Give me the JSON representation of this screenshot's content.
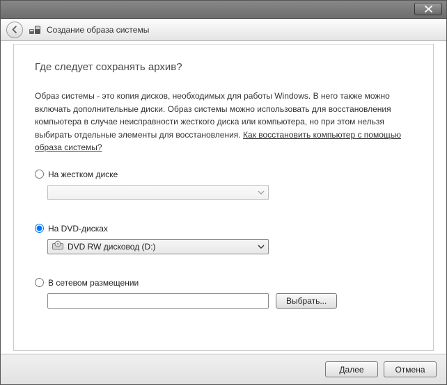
{
  "header": {
    "title": "Создание образа системы"
  },
  "page": {
    "heading": "Где следует сохранять архив?",
    "description_pre": "Образ системы - это копия дисков, необходимых для работы Windows. В него также можно включать дополнительные диски. Образ системы можно использовать для восстановления компьютера в случае неисправности жесткого диска или компьютера, но при этом нельзя выбирать отдельные элементы для восстановления. ",
    "description_link": "Как восстановить компьютер с помощью образа системы?"
  },
  "options": {
    "hdd": {
      "label": "На жестком диске",
      "selected": ""
    },
    "dvd": {
      "label": "На DVD-дисках",
      "selected": "DVD RW дисковод (D:)"
    },
    "network": {
      "label": "В сетевом размещении",
      "value": "",
      "browse": "Выбрать..."
    }
  },
  "footer": {
    "next": "Далее",
    "cancel": "Отмена"
  }
}
